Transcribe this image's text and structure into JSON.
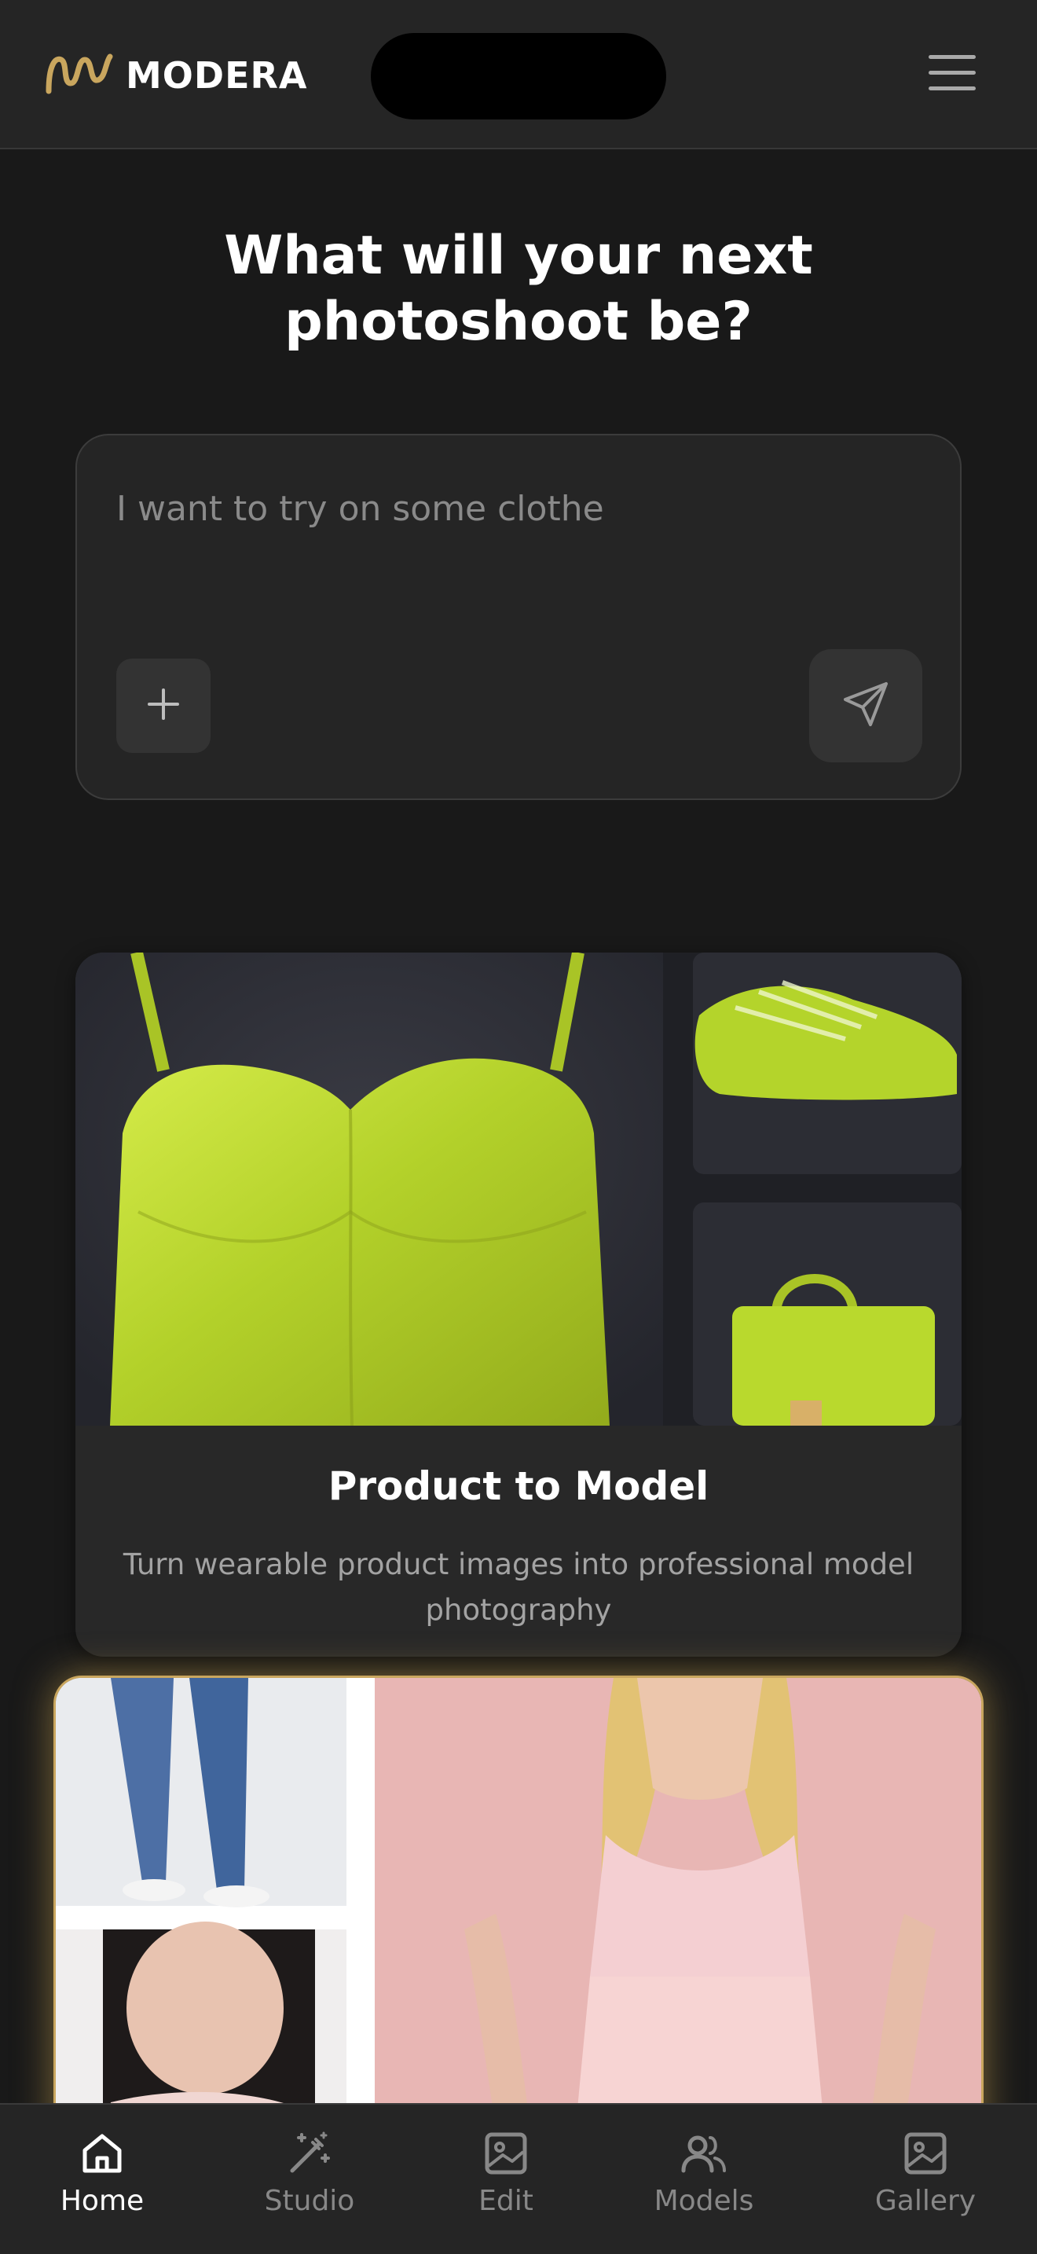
{
  "header": {
    "logo_text": "MODERA",
    "logo_icon": "modera-logo-icon",
    "menu_icon": "hamburger-menu-icon"
  },
  "headline": "What will your next photoshoot be?",
  "prompt": {
    "placeholder": "I want to try on some clothe",
    "value": "",
    "add_icon": "plus-icon",
    "send_icon": "send-icon"
  },
  "cards": [
    {
      "title": "Product to Model",
      "description": "Turn wearable product images into professional model photography",
      "images": [
        "lime-green-satin-bustier-top",
        "lime-green-sneakers",
        "lime-green-handbag"
      ]
    },
    {
      "title": "",
      "description": "",
      "images": [
        "blue-ripped-jeans-model",
        "woman-portrait",
        "pink-lace-dress-model"
      ],
      "highlighted": true
    }
  ],
  "bottom_nav": [
    {
      "label": "Home",
      "icon": "home-icon",
      "active": true
    },
    {
      "label": "Studio",
      "icon": "magic-wand-icon",
      "active": false
    },
    {
      "label": "Edit",
      "icon": "image-icon",
      "active": false
    },
    {
      "label": "Models",
      "icon": "users-icon",
      "active": false
    },
    {
      "label": "Gallery",
      "icon": "image-icon",
      "active": false
    }
  ],
  "colors": {
    "background": "#191919",
    "surface": "#252525",
    "accent_gold": "#c9a65e",
    "text_primary": "#ffffff",
    "text_secondary": "#a3a3a3",
    "product_green": "#b8d62c",
    "dress_pink": "#e7b4b2"
  }
}
